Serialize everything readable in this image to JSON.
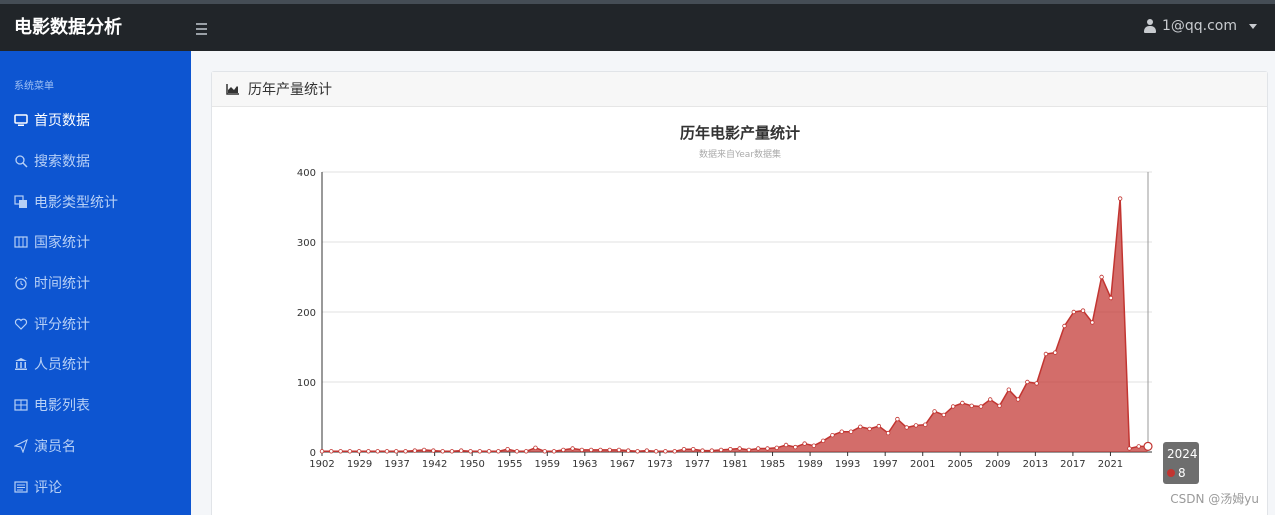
{
  "app": {
    "brand": "电影数据分析"
  },
  "user": {
    "email": "1@qq.com"
  },
  "sidebar": {
    "header": "系统菜单",
    "items": [
      {
        "label": "首页数据",
        "icon": "monitor-icon",
        "active": true
      },
      {
        "label": "搜索数据",
        "icon": "search-icon"
      },
      {
        "label": "电影类型统计",
        "icon": "copy-icon"
      },
      {
        "label": "国家统计",
        "icon": "columns-icon"
      },
      {
        "label": "时间统计",
        "icon": "alarm-clock-icon"
      },
      {
        "label": "评分统计",
        "icon": "heart-icon"
      },
      {
        "label": "人员统计",
        "icon": "bank-icon"
      },
      {
        "label": "电影列表",
        "icon": "table-icon"
      },
      {
        "label": "演员名",
        "icon": "send-icon"
      },
      {
        "label": "评论",
        "icon": "list-icon"
      }
    ]
  },
  "card": {
    "title": "历年产量统计",
    "icon": "area-chart-icon"
  },
  "tooltip": {
    "year": "2024",
    "value": "8",
    "marker_color": "#c23531"
  },
  "watermark": "CSDN @汤姆yu",
  "colors": {
    "series": "#c23531",
    "sidebar": "#0d55d1",
    "topbar": "#212529"
  },
  "chart_data": {
    "type": "area",
    "title": "历年电影产量统计",
    "subtitle": "数据来自Year数据集",
    "ylim": [
      0,
      400
    ],
    "yticks": [
      0,
      100,
      200,
      300,
      400
    ],
    "xticklabels": [
      "1902",
      "1929",
      "1937",
      "1942",
      "1950",
      "1955",
      "1959",
      "1963",
      "1967",
      "1973",
      "1977",
      "1981",
      "1985",
      "1989",
      "1993",
      "1997",
      "2001",
      "2005",
      "2009",
      "2013",
      "2017",
      "2021"
    ],
    "grid": true,
    "series": [
      {
        "values": [
          1,
          1,
          1,
          1,
          1,
          1,
          1,
          1,
          1,
          1,
          2,
          3,
          2,
          1,
          1,
          2,
          1,
          1,
          1,
          1,
          4,
          1,
          1,
          6,
          1,
          1,
          3,
          5,
          3,
          3,
          3,
          3,
          3,
          2,
          1,
          2,
          1,
          1,
          1,
          4,
          4,
          2,
          2,
          3,
          4,
          5,
          3,
          5,
          5,
          6,
          10,
          7,
          12,
          9,
          16,
          24,
          29,
          29,
          36,
          33,
          37,
          27,
          47,
          35,
          38,
          39,
          58,
          53,
          65,
          70,
          66,
          65,
          75,
          66,
          89,
          75,
          100,
          98,
          140,
          142,
          180,
          200,
          202,
          185,
          250,
          220,
          362,
          5,
          8,
          8
        ]
      }
    ]
  }
}
